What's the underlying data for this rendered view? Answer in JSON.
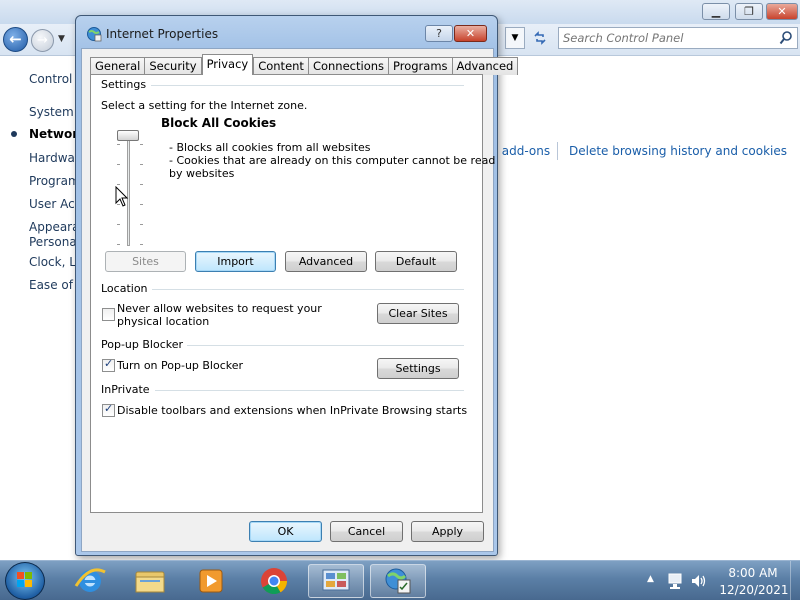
{
  "control_panel": {
    "search_placeholder": "Search Control Panel",
    "sidebar": [
      {
        "label": "Control P",
        "current": false
      },
      {
        "label": "System a",
        "current": false
      },
      {
        "label": "Network",
        "current": true
      },
      {
        "label": "Hardwa",
        "current": false
      },
      {
        "label": "Program",
        "current": false
      },
      {
        "label": "User Acc",
        "current": false
      },
      {
        "label": "Appeara",
        "current": false
      },
      {
        "label": "Personal",
        "current": false
      },
      {
        "label": "Clock, La",
        "current": false
      },
      {
        "label": "Ease of A",
        "current": false
      }
    ],
    "links": {
      "addons": "r add-ons",
      "delete_history": "Delete browsing history and cookies"
    }
  },
  "dialog": {
    "title": "Internet Properties",
    "help_label": "?",
    "close_label": "✕",
    "tabs": [
      "General",
      "Security",
      "Privacy",
      "Content",
      "Connections",
      "Programs",
      "Advanced"
    ],
    "active_tab": "Privacy",
    "settings": {
      "group_label": "Settings",
      "prompt": "Select a setting for the Internet zone.",
      "level_title": "Block All Cookies",
      "slider_level": "1 of 6 (top)",
      "description": [
        "- Blocks all cookies from all websites",
        "- Cookies that are already on this computer cannot be read",
        "by websites"
      ],
      "buttons": {
        "sites": "Sites",
        "import": "Import",
        "advanced": "Advanced",
        "default": "Default"
      }
    },
    "location": {
      "group_label": "Location",
      "checkbox_line1": "Never allow websites to request your",
      "checkbox_line2": "physical location",
      "checked": false,
      "button": "Clear Sites"
    },
    "popup": {
      "group_label": "Pop-up Blocker",
      "checkbox": "Turn on Pop-up Blocker",
      "checked": true,
      "button": "Settings"
    },
    "inprivate": {
      "group_label": "InPrivate",
      "checkbox": "Disable toolbars and extensions when InPrivate Browsing starts",
      "checked": true
    },
    "footer": {
      "ok": "OK",
      "cancel": "Cancel",
      "apply": "Apply"
    }
  },
  "taskbar": {
    "apps": [
      "internet-explorer",
      "file-explorer",
      "media-player",
      "chrome",
      "control-panel",
      "internet-properties"
    ],
    "time": "8:00 AM",
    "date": "12/20/2021"
  },
  "colors": {
    "accent": "#1a5ea9",
    "dialog_frame": "#a9c5e8",
    "taskbar": "#5b7fa6"
  }
}
